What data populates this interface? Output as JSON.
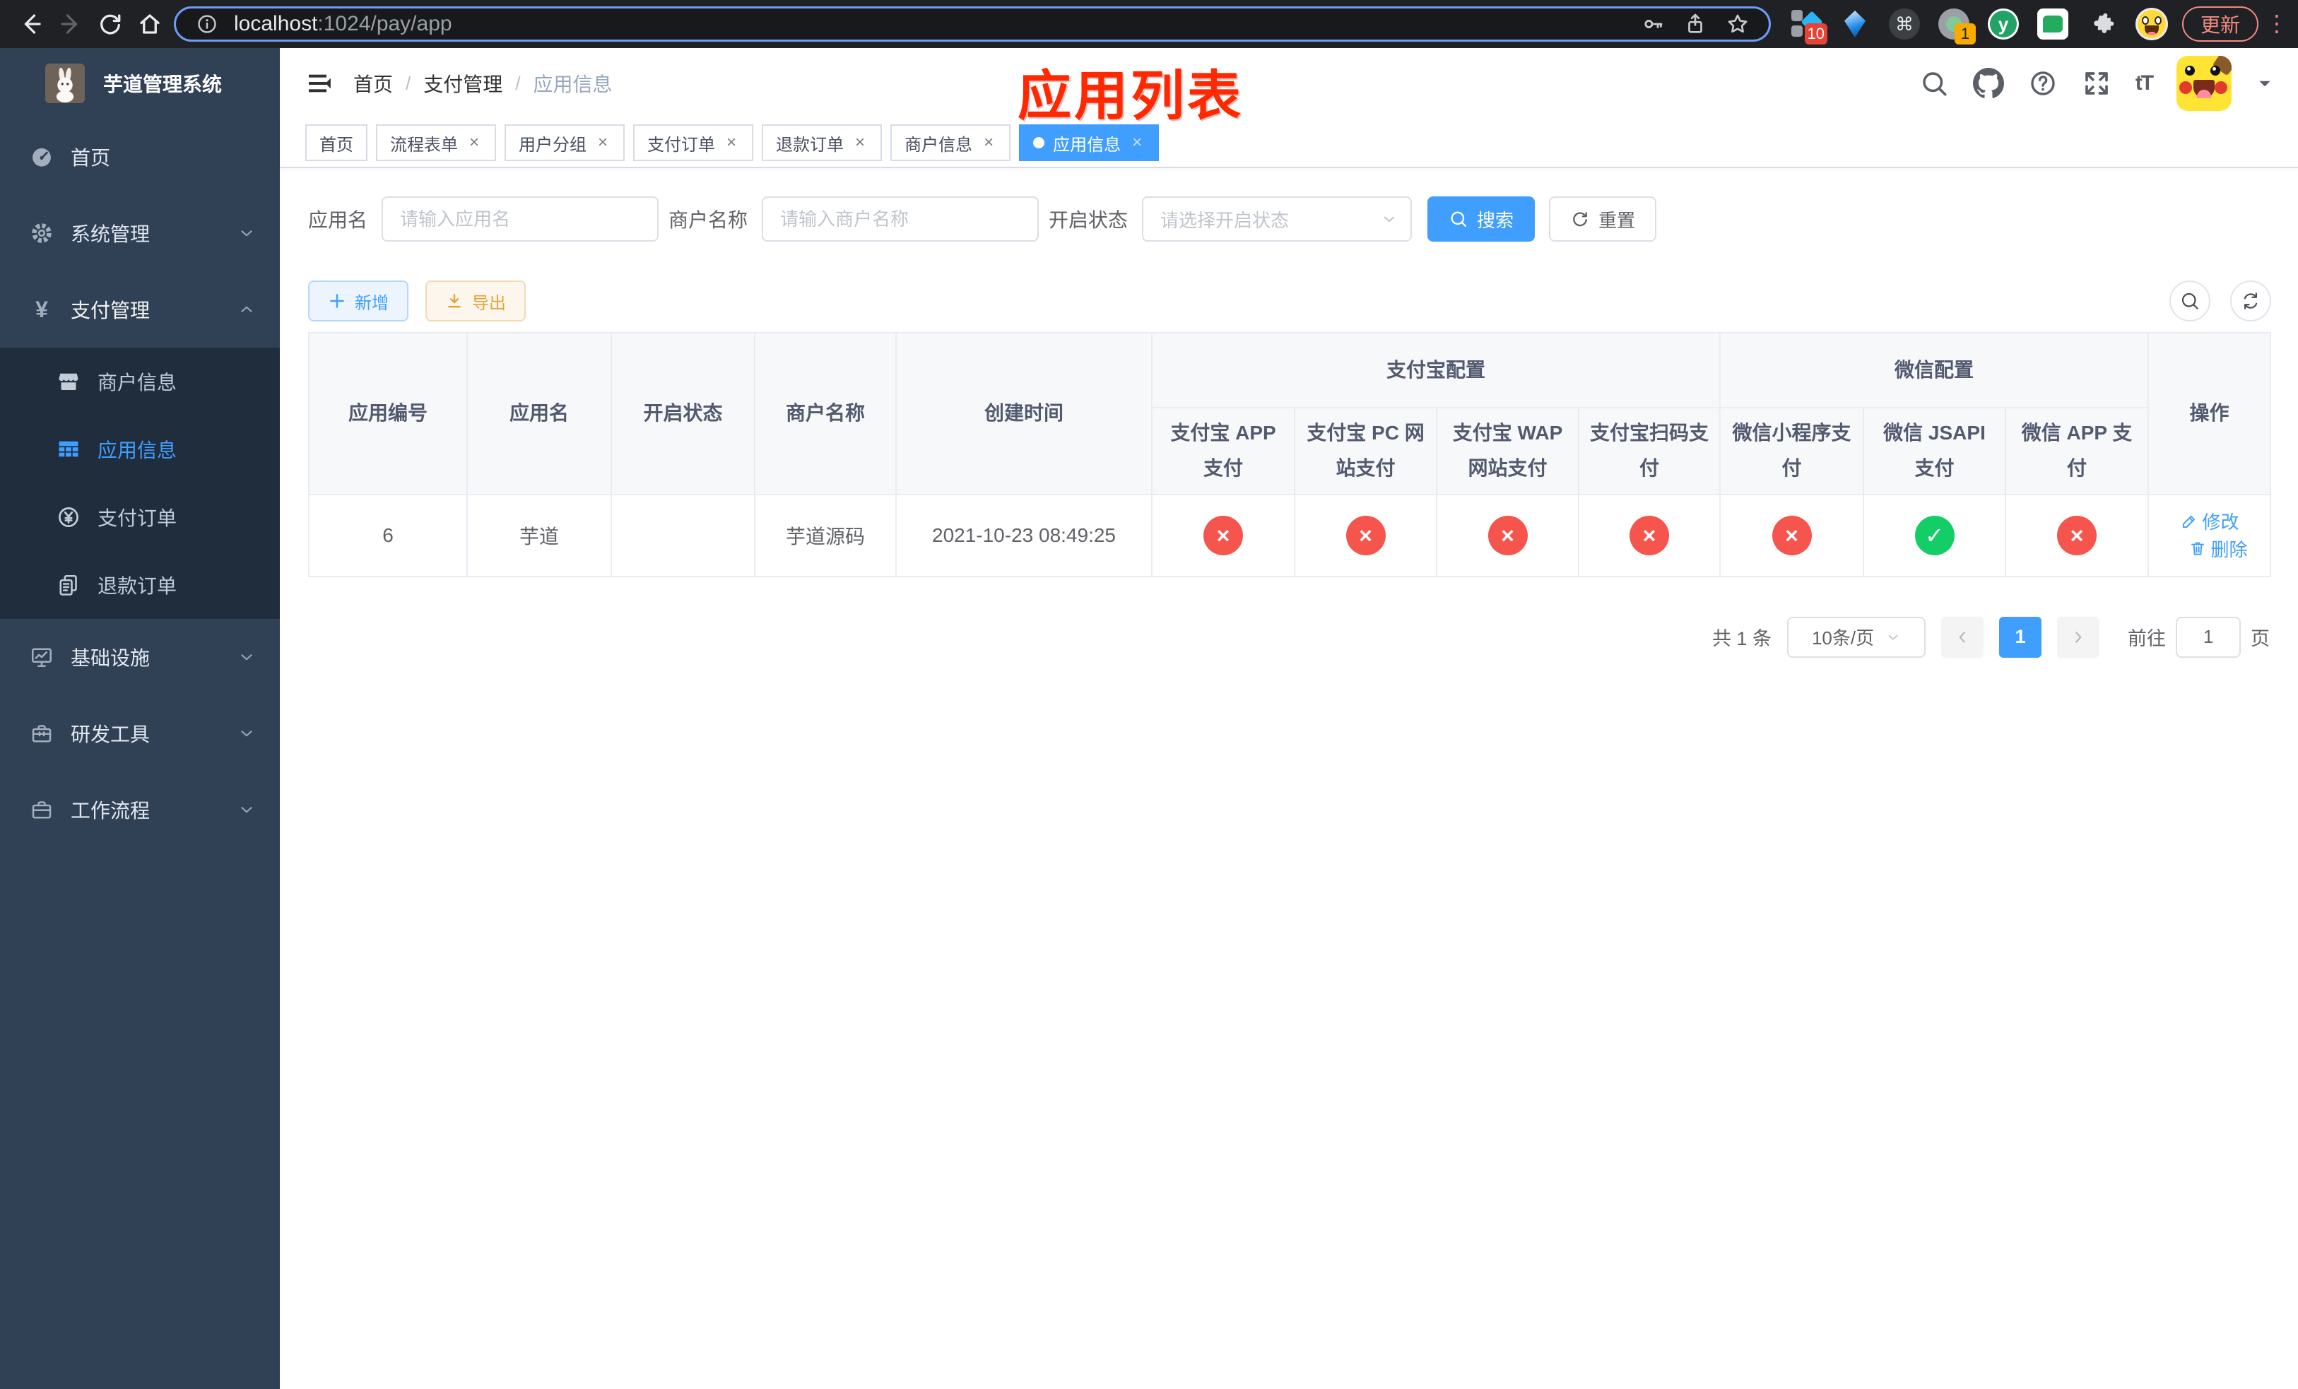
{
  "colors": {
    "accent": "#409eff",
    "danger": "#f5554d",
    "success": "#13ce66",
    "annotation_red": "#ff2800"
  },
  "glyphs": {
    "yen": "¥",
    "command": "⌘",
    "font_size": "tT",
    "y_logo": "y",
    "check": "✓",
    "cross": "×",
    "close": "×",
    "kebab": "⋮"
  },
  "browser": {
    "url_host": "localhost",
    "url_path": ":1024/pay/app",
    "update_label": "更新",
    "extensions": {
      "badge_one": "10",
      "badge_two": "1"
    }
  },
  "sidebar": {
    "title": "芋道管理系统",
    "items": [
      {
        "key": "home",
        "label": "首页"
      },
      {
        "key": "system",
        "label": "系统管理"
      },
      {
        "key": "payment",
        "label": "支付管理"
      },
      {
        "key": "merchant-info",
        "label": "商户信息"
      },
      {
        "key": "app-info",
        "label": "应用信息"
      },
      {
        "key": "pay-order",
        "label": "支付订单"
      },
      {
        "key": "refund-order",
        "label": "退款订单"
      },
      {
        "key": "infrastructure",
        "label": "基础设施"
      },
      {
        "key": "dev-tools",
        "label": "研发工具"
      },
      {
        "key": "workflow",
        "label": "工作流程"
      }
    ]
  },
  "header": {
    "breadcrumb": {
      "items": [
        "首页",
        "支付管理",
        "应用信息"
      ],
      "separator": "/"
    },
    "annotation": "应用列表"
  },
  "tabs": {
    "close_glyph": "×",
    "items": [
      {
        "key": "home",
        "label": "首页",
        "closable": false,
        "active": false
      },
      {
        "key": "flow-form",
        "label": "流程表单",
        "closable": true,
        "active": false
      },
      {
        "key": "user-group",
        "label": "用户分组",
        "closable": true,
        "active": false
      },
      {
        "key": "pay-order",
        "label": "支付订单",
        "closable": true,
        "active": false
      },
      {
        "key": "refund-order",
        "label": "退款订单",
        "closable": true,
        "active": false
      },
      {
        "key": "merchant-info",
        "label": "商户信息",
        "closable": true,
        "active": false
      },
      {
        "key": "app-info",
        "label": "应用信息",
        "closable": true,
        "active": true
      }
    ]
  },
  "filters": {
    "app_name": {
      "label": "应用名",
      "placeholder": "请输入应用名"
    },
    "merchant_name": {
      "label": "商户名称",
      "placeholder": "请输入商户名称"
    },
    "status": {
      "label": "开启状态",
      "placeholder": "请选择开启状态"
    },
    "search_label": "搜索",
    "reset_label": "重置"
  },
  "toolbar": {
    "add_label": "新增",
    "export_label": "导出"
  },
  "table": {
    "columns": [
      "应用编号",
      "应用名",
      "开启状态",
      "商户名称",
      "创建时间"
    ],
    "groups": [
      {
        "label": "支付宝配置",
        "children": [
          "支付宝 APP 支付",
          "支付宝 PC 网站支付",
          "支付宝 WAP 网站支付",
          "支付宝扫码支付"
        ]
      },
      {
        "label": "微信配置",
        "children": [
          "微信小程序支付",
          "微信 JSAPI 支付",
          "微信 APP 支付"
        ]
      }
    ],
    "action_column": "操作",
    "rows": [
      {
        "id": "6",
        "name": "芋道",
        "enabled": true,
        "merchant": "芋道源码",
        "created": "2021-10-23 08:49:25",
        "flags": {
          "alipay_app": false,
          "alipay_pc": false,
          "alipay_wap": false,
          "alipay_qr": false,
          "wechat_mini": false,
          "wechat_jsapi": true,
          "wechat_app": false
        },
        "edit_label": "修改",
        "delete_label": "删除"
      }
    ]
  },
  "pagination": {
    "total_text": "共 1 条",
    "page_size_text": "10条/页",
    "current_page": "1",
    "goto_label": "前往",
    "goto_value": "1",
    "goto_suffix": "页"
  }
}
